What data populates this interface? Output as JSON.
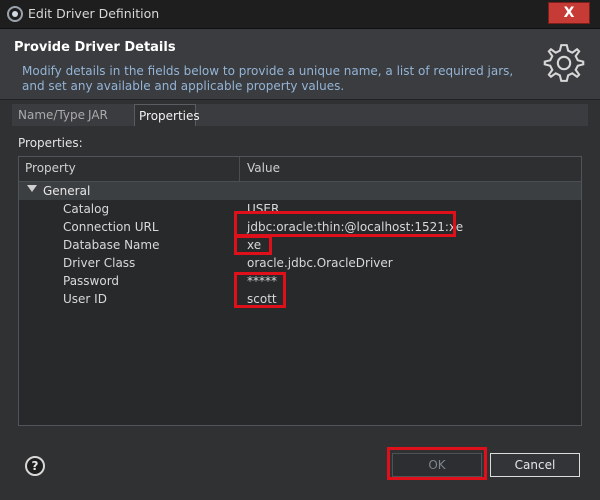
{
  "window": {
    "title": "Edit Driver Definition",
    "close_label": "X"
  },
  "header": {
    "title": "Provide Driver Details",
    "description": "Modify details in the fields below to provide a unique name, a list of required jars, and set any available and applicable property values."
  },
  "tabs": [
    {
      "label": "Name/Type"
    },
    {
      "label": "JAR List"
    },
    {
      "label": "Properties"
    }
  ],
  "panel": {
    "label": "Properties:"
  },
  "table": {
    "columns": [
      "Property",
      "Value"
    ],
    "group": "General",
    "rows": [
      {
        "key": "Catalog",
        "value": "USER"
      },
      {
        "key": "Connection URL",
        "value": "jdbc:oracle:thin:@localhost:1521:xe"
      },
      {
        "key": "Database Name",
        "value": "xe"
      },
      {
        "key": "Driver Class",
        "value": "oracle.jdbc.OracleDriver"
      },
      {
        "key": "Password",
        "value": "*****"
      },
      {
        "key": "User ID",
        "value": "scott"
      }
    ]
  },
  "footer": {
    "help_label": "?",
    "ok_label": "OK",
    "cancel_label": "Cancel"
  },
  "colors": {
    "highlight": "#e0101a",
    "accent_text": "#94b4d6"
  }
}
